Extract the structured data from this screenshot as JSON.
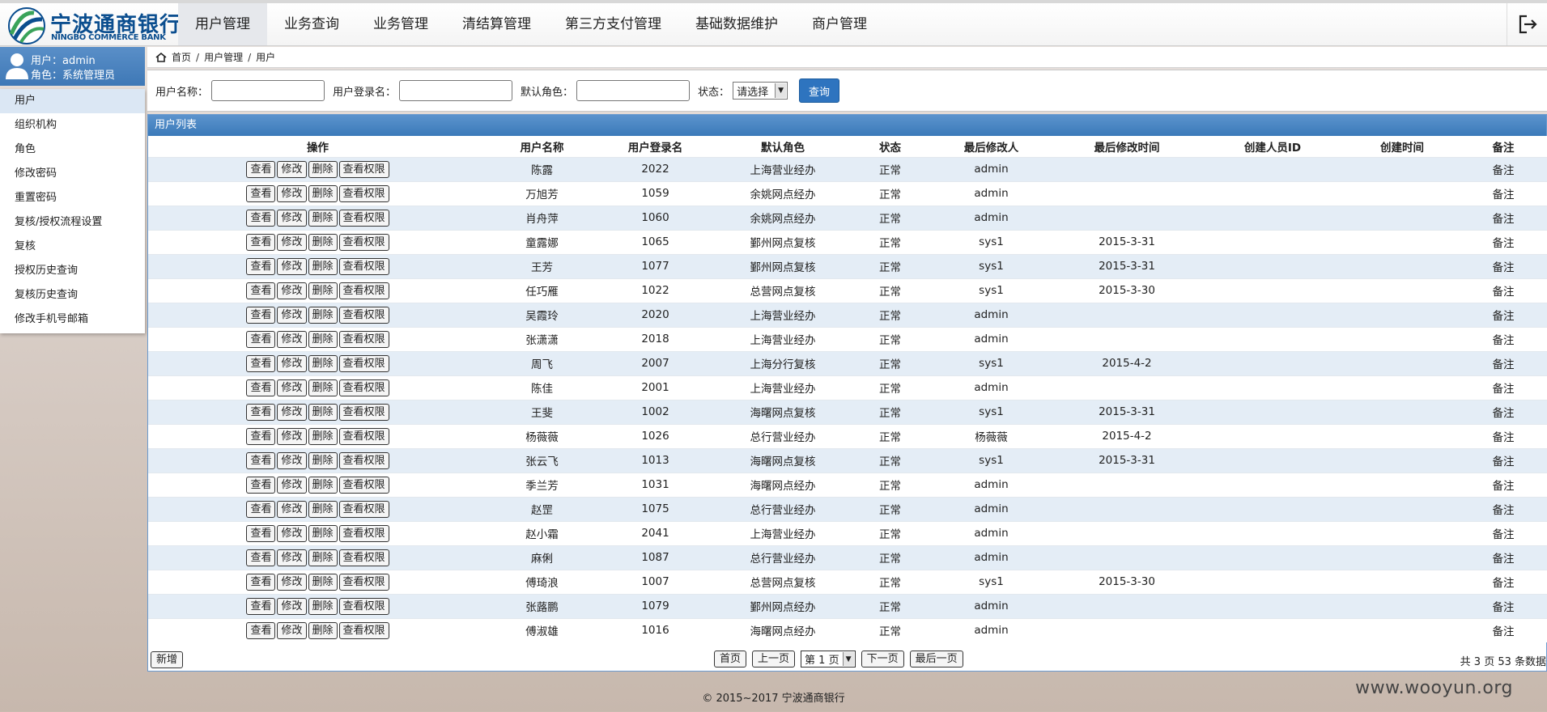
{
  "brand": {
    "name_cn": "宁波通商银行",
    "name_en": "NINGBO COMMERCE BANK",
    "colors": {
      "primary": "#0b4e8f",
      "accent": "#3e78b6",
      "logo_green": "#3aa35a"
    }
  },
  "nav": {
    "items": [
      "用户管理",
      "业务查询",
      "业务管理",
      "清结算管理",
      "第三方支付管理",
      "基础数据维护",
      "商户管理"
    ],
    "active_index": 0,
    "logout_icon": "logout-icon"
  },
  "user": {
    "line1": "用户：admin",
    "line2": "角色：系统管理员",
    "icon": "user-avatar-icon"
  },
  "sidebar": {
    "items": [
      "用户",
      "组织机构",
      "角色",
      "修改密码",
      "重置密码",
      "复核/授权流程设置",
      "复核",
      "授权历史查询",
      "复核历史查询",
      "修改手机号邮箱"
    ],
    "active_index": 0
  },
  "breadcrumb": {
    "icon": "home-icon",
    "items": [
      "首页",
      "用户管理",
      "用户"
    ],
    "separator": "/"
  },
  "search": {
    "username_label": "用户名称：",
    "login_label": "用户登录名：",
    "role_label": "默认角色：",
    "status_label": "状态：",
    "status_value": "请选择",
    "query_button": "查询"
  },
  "grid": {
    "title": "用户列表",
    "columns": [
      "操作",
      "用户名称",
      "用户登录名",
      "默认角色",
      "状态",
      "最后修改人",
      "最后修改时间",
      "创建人员ID",
      "创建时间",
      "备注"
    ],
    "action_labels": [
      "查看",
      "修改",
      "删除",
      "查看权限"
    ],
    "rows": [
      {
        "name": "陈露",
        "login": "2022",
        "role": "上海营业经办",
        "status": "正常",
        "modifier": "admin",
        "modified": "",
        "creator": "",
        "created": "",
        "note": "备注"
      },
      {
        "name": "万旭芳",
        "login": "1059",
        "role": "余姚网点经办",
        "status": "正常",
        "modifier": "admin",
        "modified": "",
        "creator": "",
        "created": "",
        "note": "备注"
      },
      {
        "name": "肖舟萍",
        "login": "1060",
        "role": "余姚网点经办",
        "status": "正常",
        "modifier": "admin",
        "modified": "",
        "creator": "",
        "created": "",
        "note": "备注"
      },
      {
        "name": "童露娜",
        "login": "1065",
        "role": "鄞州网点复核",
        "status": "正常",
        "modifier": "sys1",
        "modified": "2015-3-31",
        "creator": "",
        "created": "",
        "note": "备注"
      },
      {
        "name": "王芳",
        "login": "1077",
        "role": "鄞州网点复核",
        "status": "正常",
        "modifier": "sys1",
        "modified": "2015-3-31",
        "creator": "",
        "created": "",
        "note": "备注"
      },
      {
        "name": "任巧雁",
        "login": "1022",
        "role": "总营网点复核",
        "status": "正常",
        "modifier": "sys1",
        "modified": "2015-3-30",
        "creator": "",
        "created": "",
        "note": "备注"
      },
      {
        "name": "吴霞玲",
        "login": "2020",
        "role": "上海营业经办",
        "status": "正常",
        "modifier": "admin",
        "modified": "",
        "creator": "",
        "created": "",
        "note": "备注"
      },
      {
        "name": "张潇潇",
        "login": "2018",
        "role": "上海营业经办",
        "status": "正常",
        "modifier": "admin",
        "modified": "",
        "creator": "",
        "created": "",
        "note": "备注"
      },
      {
        "name": "周飞",
        "login": "2007",
        "role": "上海分行复核",
        "status": "正常",
        "modifier": "sys1",
        "modified": "2015-4-2",
        "creator": "",
        "created": "",
        "note": "备注"
      },
      {
        "name": "陈佳",
        "login": "2001",
        "role": "上海营业经办",
        "status": "正常",
        "modifier": "admin",
        "modified": "",
        "creator": "",
        "created": "",
        "note": "备注"
      },
      {
        "name": "王斐",
        "login": "1002",
        "role": "海曙网点复核",
        "status": "正常",
        "modifier": "sys1",
        "modified": "2015-3-31",
        "creator": "",
        "created": "",
        "note": "备注"
      },
      {
        "name": "杨薇薇",
        "login": "1026",
        "role": "总行营业经办",
        "status": "正常",
        "modifier": "杨薇薇",
        "modified": "2015-4-2",
        "creator": "",
        "created": "",
        "note": "备注"
      },
      {
        "name": "张云飞",
        "login": "1013",
        "role": "海曙网点复核",
        "status": "正常",
        "modifier": "sys1",
        "modified": "2015-3-31",
        "creator": "",
        "created": "",
        "note": "备注"
      },
      {
        "name": "季兰芳",
        "login": "1031",
        "role": "海曙网点经办",
        "status": "正常",
        "modifier": "admin",
        "modified": "",
        "creator": "",
        "created": "",
        "note": "备注"
      },
      {
        "name": "赵罡",
        "login": "1075",
        "role": "总行营业经办",
        "status": "正常",
        "modifier": "admin",
        "modified": "",
        "creator": "",
        "created": "",
        "note": "备注"
      },
      {
        "name": "赵小霜",
        "login": "2041",
        "role": "上海营业经办",
        "status": "正常",
        "modifier": "admin",
        "modified": "",
        "creator": "",
        "created": "",
        "note": "备注"
      },
      {
        "name": "麻俐",
        "login": "1087",
        "role": "总行营业经办",
        "status": "正常",
        "modifier": "admin",
        "modified": "",
        "creator": "",
        "created": "",
        "note": "备注"
      },
      {
        "name": "傅琦浪",
        "login": "1007",
        "role": "总营网点复核",
        "status": "正常",
        "modifier": "sys1",
        "modified": "2015-3-30",
        "creator": "",
        "created": "",
        "note": "备注"
      },
      {
        "name": "张蕗鹏",
        "login": "1079",
        "role": "鄞州网点经办",
        "status": "正常",
        "modifier": "admin",
        "modified": "",
        "creator": "",
        "created": "",
        "note": "备注"
      },
      {
        "name": "傅淑雄",
        "login": "1016",
        "role": "海曙网点经办",
        "status": "正常",
        "modifier": "admin",
        "modified": "",
        "creator": "",
        "created": "",
        "note": "备注"
      }
    ]
  },
  "pagination": {
    "add_button": "新增",
    "first": "首页",
    "prev": "上一页",
    "current": "第 1 页",
    "next": "下一页",
    "last": "最后一页",
    "summary": "共 3 页 53 条数据"
  },
  "footer": {
    "copyright": "© 2015~2017 宁波通商银行",
    "watermark": "www.wooyun.org"
  }
}
